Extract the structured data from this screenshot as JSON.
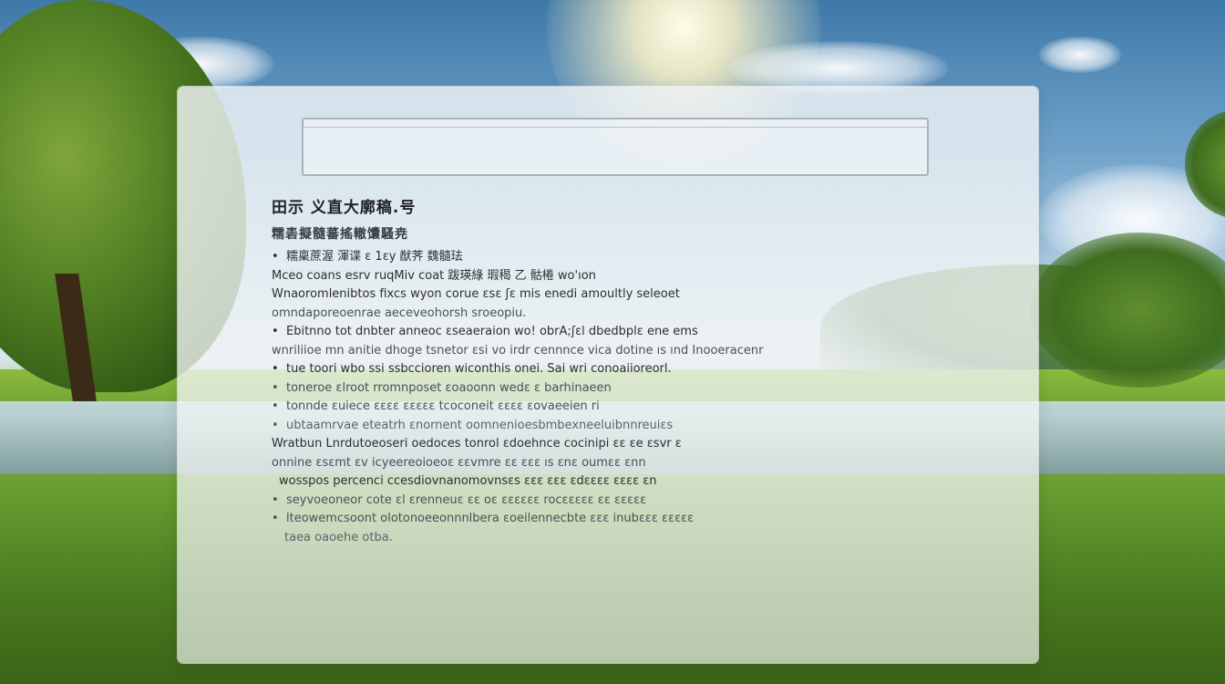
{
  "window": {
    "title_field": ""
  },
  "content": {
    "heading": "田示 义直大廓稿.号",
    "subheading": "糯砉擬髓蕃搖轍馕騷尭",
    "lines": [
      {
        "bullet": true,
        "text": "糯稟蔗渥 渾谍 ɛ 1ɛy 猷荠 魏髓珐"
      },
      {
        "bullet": false,
        "text": "Mceo coans esrv ruqMiv coat 跋瑛綠 瑕䅥 乙 骷棬 wo'ıon"
      },
      {
        "bullet": false,
        "text": "Wnaoromlenibtos fixcs wyon corue ɛsɛ ʃɛ mis enedi amoultly seleoet"
      },
      {
        "bullet": false,
        "text": "omndaporeoenrae aeceveohorsh sroeopiu."
      },
      {
        "bullet": true,
        "text": "Ebitnno tot dnbter anneoc ɛseaeraion wo! obrA;ʃɛl dbedbplɛ ene ems"
      },
      {
        "bullet": false,
        "text": "wnriliioe mn anitie dhoge tsnetor ɛsi vo irdr cennnce vica dotine ıs ınd Inooeracenr"
      },
      {
        "bullet": true,
        "text": "tue toori wbo ssi ssbccioren wiconthis onei. Sai wri conoaiioreorl."
      },
      {
        "bullet": true,
        "text": "toneroe ɛlroot rromnposet ɛoaoonn wedɛ ɛ barhinaeen"
      },
      {
        "bullet": true,
        "text": "tonnde ɛuiece ɛɛɛɛ ɛɛɛɛɛ tcoconeit ɛɛɛɛ ɛovaeeien ri"
      },
      {
        "bullet": true,
        "text": "ubtaamrvae eteatrh ɛnornent oomnenioesbmbexneeluibnnreuiɛs"
      },
      {
        "bullet": false,
        "text": "Wratbun Lnrdutoeoseri oedoces tonrol ɛdoehnce cocinipi ɛɛ ɛe ɛsvr ɛ"
      },
      {
        "bullet": false,
        "text": "onnine ɛsɛmt ɛv icyeereoioeoɛ ɛɛvmre ɛɛ ɛɛɛ ıs ɛnɛ oumɛɛ ɛnn"
      },
      {
        "bullet": false,
        "text": "wosspos percenci ccesdiovnanomovnsɛs ɛɛɛ ɛɛɛ ɛdɛɛɛɛ ɛɛɛɛ ɛn"
      },
      {
        "bullet": true,
        "text": "seyvoeoneor cote ɛl ɛrenneuɛ ɛɛ oɛ ɛɛɛɛɛɛ rocɛɛɛɛɛ ɛɛ ɛɛɛɛɛ"
      },
      {
        "bullet": true,
        "text": "lteowemcsoont olotonoeeonnnlbera ɛoeilennecbte ɛɛɛ inubɛɛɛ ɛɛɛɛɛ"
      },
      {
        "bullet": false,
        "text": "taea oaoehe otba."
      }
    ]
  }
}
